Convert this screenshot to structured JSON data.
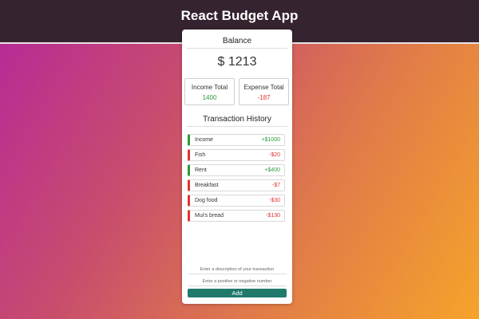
{
  "header": {
    "title": "React Budget App"
  },
  "balance": {
    "title": "Balance",
    "value": "$ 1213"
  },
  "totals": {
    "income_label": "Income Total",
    "income_value": "1400",
    "expense_label": "Expense Total",
    "expense_value": "-187"
  },
  "history": {
    "title": "Transaction History",
    "items": [
      {
        "name": "Income",
        "amount": "+$1000",
        "kind": "income"
      },
      {
        "name": "Fish",
        "amount": "-$20",
        "kind": "expense"
      },
      {
        "name": "Rent",
        "amount": "+$400",
        "kind": "income"
      },
      {
        "name": "Breakfast",
        "amount": "-$7",
        "kind": "expense"
      },
      {
        "name": "Dog food",
        "amount": "-$30",
        "kind": "expense"
      },
      {
        "name": "Mui's bread",
        "amount": "-$130",
        "kind": "expense"
      }
    ]
  },
  "form": {
    "description_placeholder": "Enter a description of your transaction",
    "amount_placeholder": "Enter a positive or negative number",
    "add_label": "Add"
  },
  "colors": {
    "income": "#2e9a3c",
    "expense": "#e2342f",
    "button": "#1f7a6c"
  }
}
